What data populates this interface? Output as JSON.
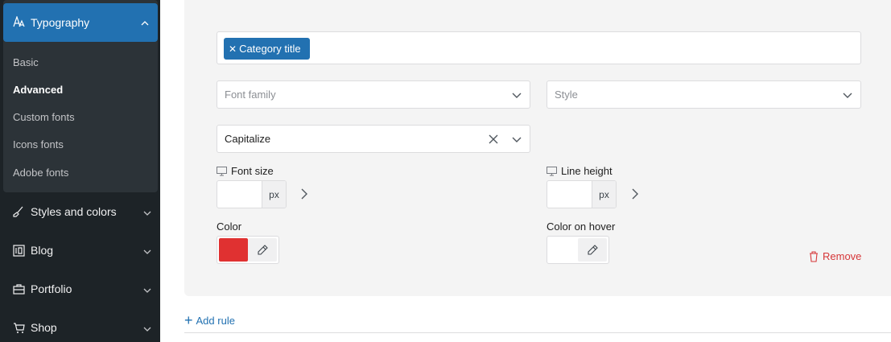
{
  "sidebar": {
    "typography": {
      "label": "Typography",
      "icon": "typography-icon"
    },
    "submenu": [
      "Basic",
      "Advanced",
      "Custom fonts",
      "Icons fonts",
      "Adobe fonts"
    ],
    "active_submenu": "Advanced",
    "items": [
      {
        "label": "Styles and colors",
        "icon": "brush-icon"
      },
      {
        "label": "Blog",
        "icon": "blog-icon"
      },
      {
        "label": "Portfolio",
        "icon": "briefcase-icon"
      },
      {
        "label": "Shop",
        "icon": "cart-icon"
      }
    ]
  },
  "rule": {
    "selectors": [
      "Category title"
    ],
    "font_family": {
      "placeholder": "Font family",
      "value": ""
    },
    "style": {
      "placeholder": "Style",
      "value": ""
    },
    "transform": {
      "value": "Capitalize"
    },
    "font_size": {
      "label": "Font size",
      "value": "",
      "unit": "px"
    },
    "line_height": {
      "label": "Line height",
      "value": "",
      "unit": "px"
    },
    "color": {
      "label": "Color",
      "value": "#e03131"
    },
    "color_hover": {
      "label": "Color on hover",
      "value": ""
    },
    "remove_label": "Remove"
  },
  "add_rule_label": "Add rule",
  "colors": {
    "accent": "#2271b1",
    "sidebar_bg": "#1d2327",
    "danger": "#d63638"
  }
}
